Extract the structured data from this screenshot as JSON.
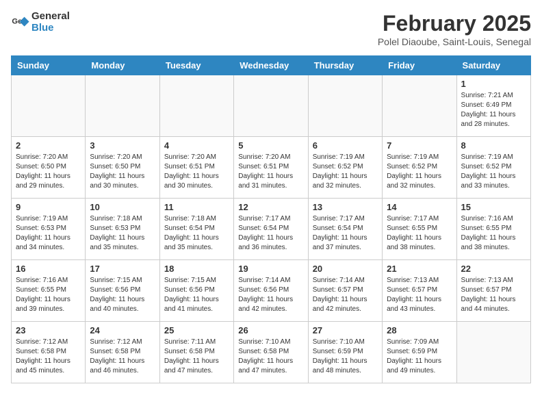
{
  "header": {
    "logo_line1": "General",
    "logo_line2": "Blue",
    "month_year": "February 2025",
    "location": "Polel Diaoube, Saint-Louis, Senegal"
  },
  "weekdays": [
    "Sunday",
    "Monday",
    "Tuesday",
    "Wednesday",
    "Thursday",
    "Friday",
    "Saturday"
  ],
  "weeks": [
    [
      {
        "num": "",
        "info": ""
      },
      {
        "num": "",
        "info": ""
      },
      {
        "num": "",
        "info": ""
      },
      {
        "num": "",
        "info": ""
      },
      {
        "num": "",
        "info": ""
      },
      {
        "num": "",
        "info": ""
      },
      {
        "num": "1",
        "info": "Sunrise: 7:21 AM\nSunset: 6:49 PM\nDaylight: 11 hours\nand 28 minutes."
      }
    ],
    [
      {
        "num": "2",
        "info": "Sunrise: 7:20 AM\nSunset: 6:50 PM\nDaylight: 11 hours\nand 29 minutes."
      },
      {
        "num": "3",
        "info": "Sunrise: 7:20 AM\nSunset: 6:50 PM\nDaylight: 11 hours\nand 30 minutes."
      },
      {
        "num": "4",
        "info": "Sunrise: 7:20 AM\nSunset: 6:51 PM\nDaylight: 11 hours\nand 30 minutes."
      },
      {
        "num": "5",
        "info": "Sunrise: 7:20 AM\nSunset: 6:51 PM\nDaylight: 11 hours\nand 31 minutes."
      },
      {
        "num": "6",
        "info": "Sunrise: 7:19 AM\nSunset: 6:52 PM\nDaylight: 11 hours\nand 32 minutes."
      },
      {
        "num": "7",
        "info": "Sunrise: 7:19 AM\nSunset: 6:52 PM\nDaylight: 11 hours\nand 32 minutes."
      },
      {
        "num": "8",
        "info": "Sunrise: 7:19 AM\nSunset: 6:52 PM\nDaylight: 11 hours\nand 33 minutes."
      }
    ],
    [
      {
        "num": "9",
        "info": "Sunrise: 7:19 AM\nSunset: 6:53 PM\nDaylight: 11 hours\nand 34 minutes."
      },
      {
        "num": "10",
        "info": "Sunrise: 7:18 AM\nSunset: 6:53 PM\nDaylight: 11 hours\nand 35 minutes."
      },
      {
        "num": "11",
        "info": "Sunrise: 7:18 AM\nSunset: 6:54 PM\nDaylight: 11 hours\nand 35 minutes."
      },
      {
        "num": "12",
        "info": "Sunrise: 7:17 AM\nSunset: 6:54 PM\nDaylight: 11 hours\nand 36 minutes."
      },
      {
        "num": "13",
        "info": "Sunrise: 7:17 AM\nSunset: 6:54 PM\nDaylight: 11 hours\nand 37 minutes."
      },
      {
        "num": "14",
        "info": "Sunrise: 7:17 AM\nSunset: 6:55 PM\nDaylight: 11 hours\nand 38 minutes."
      },
      {
        "num": "15",
        "info": "Sunrise: 7:16 AM\nSunset: 6:55 PM\nDaylight: 11 hours\nand 38 minutes."
      }
    ],
    [
      {
        "num": "16",
        "info": "Sunrise: 7:16 AM\nSunset: 6:55 PM\nDaylight: 11 hours\nand 39 minutes."
      },
      {
        "num": "17",
        "info": "Sunrise: 7:15 AM\nSunset: 6:56 PM\nDaylight: 11 hours\nand 40 minutes."
      },
      {
        "num": "18",
        "info": "Sunrise: 7:15 AM\nSunset: 6:56 PM\nDaylight: 11 hours\nand 41 minutes."
      },
      {
        "num": "19",
        "info": "Sunrise: 7:14 AM\nSunset: 6:56 PM\nDaylight: 11 hours\nand 42 minutes."
      },
      {
        "num": "20",
        "info": "Sunrise: 7:14 AM\nSunset: 6:57 PM\nDaylight: 11 hours\nand 42 minutes."
      },
      {
        "num": "21",
        "info": "Sunrise: 7:13 AM\nSunset: 6:57 PM\nDaylight: 11 hours\nand 43 minutes."
      },
      {
        "num": "22",
        "info": "Sunrise: 7:13 AM\nSunset: 6:57 PM\nDaylight: 11 hours\nand 44 minutes."
      }
    ],
    [
      {
        "num": "23",
        "info": "Sunrise: 7:12 AM\nSunset: 6:58 PM\nDaylight: 11 hours\nand 45 minutes."
      },
      {
        "num": "24",
        "info": "Sunrise: 7:12 AM\nSunset: 6:58 PM\nDaylight: 11 hours\nand 46 minutes."
      },
      {
        "num": "25",
        "info": "Sunrise: 7:11 AM\nSunset: 6:58 PM\nDaylight: 11 hours\nand 47 minutes."
      },
      {
        "num": "26",
        "info": "Sunrise: 7:10 AM\nSunset: 6:58 PM\nDaylight: 11 hours\nand 47 minutes."
      },
      {
        "num": "27",
        "info": "Sunrise: 7:10 AM\nSunset: 6:59 PM\nDaylight: 11 hours\nand 48 minutes."
      },
      {
        "num": "28",
        "info": "Sunrise: 7:09 AM\nSunset: 6:59 PM\nDaylight: 11 hours\nand 49 minutes."
      },
      {
        "num": "",
        "info": ""
      }
    ]
  ]
}
